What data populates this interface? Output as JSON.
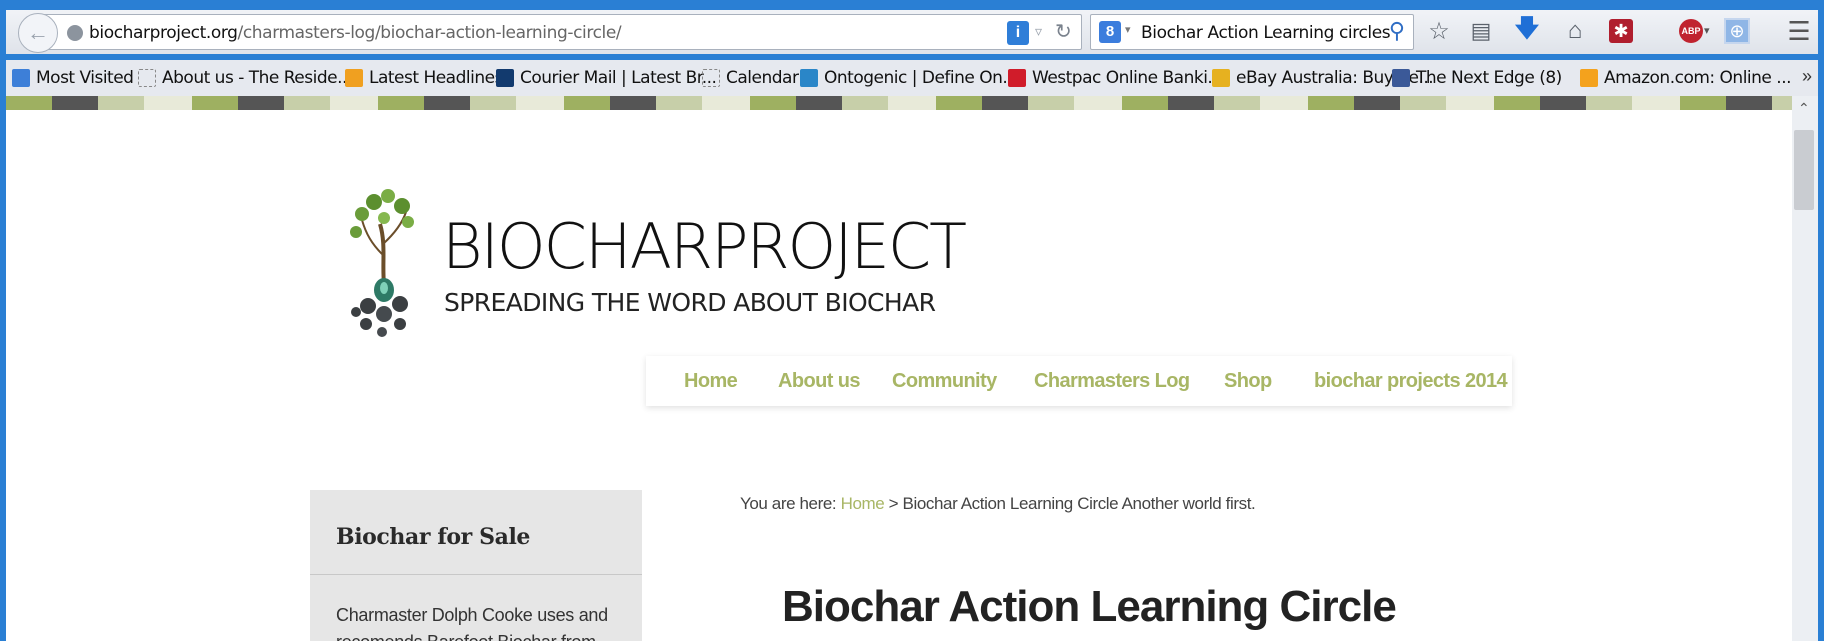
{
  "browser": {
    "url_domain": "biocharproject.org",
    "url_path": "/charmasters-log/biochar-action-learning-circle/",
    "search_query": "Biochar Action Learning circles",
    "bookmarks": [
      "Most Visited",
      "About us - The Reside...",
      "Latest Headlines",
      "Courier Mail | Latest Br...",
      "Calendar",
      "Ontogenic | Define On...",
      "Westpac Online Banki...",
      "eBay Australia: Buy ne...",
      "The Next Edge (8)",
      "Amazon.com: Online ..."
    ],
    "chevron": "»"
  },
  "site": {
    "brand": "BIOCHARPROJECT",
    "tagline": "SPREADING THE WORD ABOUT BIOCHAR",
    "nav": [
      "Home",
      "About us",
      "Community",
      "Charmasters Log",
      "Shop",
      "biochar projects 2014"
    ],
    "accent_color": "#a8b665"
  },
  "sidebar": {
    "title": "Biochar for Sale",
    "text": "Charmaster Dolph Cooke uses and recomends Barefoot Biochar from"
  },
  "content": {
    "breadcrumb_prefix": "You are here: ",
    "breadcrumb_home": "Home",
    "breadcrumb_rest": " > Biochar Action Learning Circle Another world first.",
    "title": "Biochar Action Learning Circle"
  }
}
